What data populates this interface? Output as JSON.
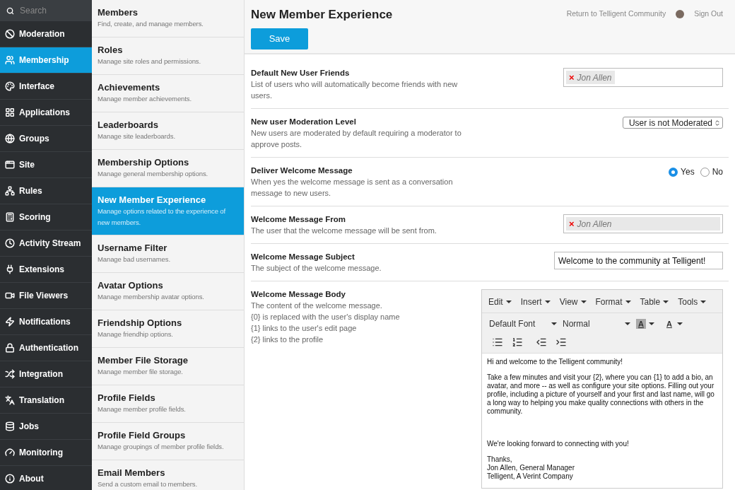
{
  "search": {
    "placeholder": "Search"
  },
  "nav": [
    {
      "label": "Moderation",
      "selected": false
    },
    {
      "label": "Membership",
      "selected": true
    },
    {
      "label": "Interface",
      "selected": false
    },
    {
      "label": "Applications",
      "selected": false
    },
    {
      "label": "Groups",
      "selected": false
    },
    {
      "label": "Site",
      "selected": false
    },
    {
      "label": "Rules",
      "selected": false
    },
    {
      "label": "Scoring",
      "selected": false
    },
    {
      "label": "Activity Stream",
      "selected": false
    },
    {
      "label": "Extensions",
      "selected": false
    },
    {
      "label": "File Viewers",
      "selected": false
    },
    {
      "label": "Notifications",
      "selected": false
    },
    {
      "label": "Authentication",
      "selected": false
    },
    {
      "label": "Integration",
      "selected": false
    },
    {
      "label": "Translation",
      "selected": false
    },
    {
      "label": "Jobs",
      "selected": false
    },
    {
      "label": "Monitoring",
      "selected": false
    },
    {
      "label": "About",
      "selected": false
    }
  ],
  "subnav": [
    {
      "title": "Members",
      "description": "Find, create, and manage members.",
      "selected": false
    },
    {
      "title": "Roles",
      "description": "Manage site roles and permissions.",
      "selected": false
    },
    {
      "title": "Achievements",
      "description": "Manage member achievements.",
      "selected": false
    },
    {
      "title": "Leaderboards",
      "description": "Manage site leaderboards.",
      "selected": false
    },
    {
      "title": "Membership Options",
      "description": "Manage general membership options.",
      "selected": false
    },
    {
      "title": "New Member Experience",
      "description": "Manage options related to the experience of new members.",
      "selected": true
    },
    {
      "title": "Username Filter",
      "description": "Manage bad usernames.",
      "selected": false
    },
    {
      "title": "Avatar Options",
      "description": "Manage membership avatar options.",
      "selected": false
    },
    {
      "title": "Friendship Options",
      "description": "Manage friendhip options.",
      "selected": false
    },
    {
      "title": "Member File Storage",
      "description": "Manage member file storage.",
      "selected": false
    },
    {
      "title": "Profile Fields",
      "description": "Manage member profile fields.",
      "selected": false
    },
    {
      "title": "Profile Field Groups",
      "description": "Manage groupings of member profile fields.",
      "selected": false
    },
    {
      "title": "Email Members",
      "description": "Send a custom email to members.",
      "selected": false
    }
  ],
  "header": {
    "title": "New Member Experience",
    "return_link": "Return to Telligent Community",
    "sign_out": "Sign Out",
    "save_button": "Save"
  },
  "fields": [
    {
      "kind": "picker",
      "label": "Default New User Friends",
      "description": [
        "List of users who will automatically become friends with new users."
      ],
      "token": "Jon Allen",
      "remove": "×"
    },
    {
      "kind": "select",
      "label": "New user Moderation Level",
      "description": [
        "New users are moderated by default requiring a moderator to approve posts."
      ],
      "value": "User is not Moderated"
    },
    {
      "kind": "radio",
      "label": "Deliver Welcome Message",
      "description": [
        "When yes the welcome message is sent as a conversation message to new users."
      ],
      "options": [
        {
          "label": "Yes",
          "selected": true
        },
        {
          "label": "No",
          "selected": false
        }
      ]
    },
    {
      "kind": "picker",
      "label": "Welcome Message From",
      "description": [
        "The user that the welcome message will be sent from."
      ],
      "token": "Jon Allen",
      "remove": "×"
    },
    {
      "kind": "text",
      "label": "Welcome Message Subject",
      "description": [
        "The subject of the welcome message."
      ],
      "value": "Welcome to the community at Telligent!"
    },
    {
      "kind": "editor",
      "label": "Welcome Message Body",
      "description": [
        "The content of the welcome message.",
        "{0} is replaced with the user's display name",
        "{1} links to the user's edit page",
        "{2} links to the profile"
      ],
      "menus": [
        "Edit",
        "Insert",
        "View",
        "Format",
        "Table",
        "Tools"
      ],
      "font": "Default Font",
      "size": "Normal",
      "highlight_label": "A",
      "text_color_label": "A",
      "body": [
        "Hi and welcome to the Telligent community!",
        "Take a few minutes and visit your {2}, where you can {1} to add a bio, an avatar, and more -- as well as configure your site options. Filling out your profile, including a picture of yourself and your first and last name, will go a long way to helping you make quality connections with others in the community.",
        "We're looking forward to connecting with you!",
        "Thanks,\nJon Allen, General Manager\nTelligent, A Verint Company"
      ]
    }
  ]
}
